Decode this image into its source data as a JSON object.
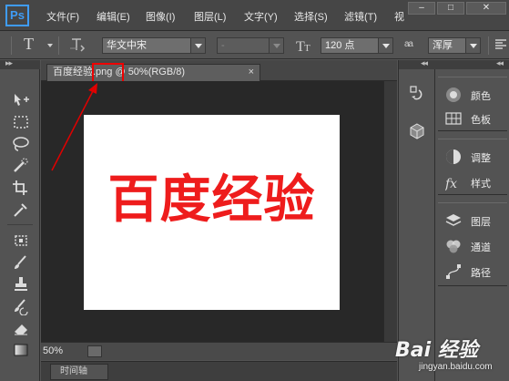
{
  "app": {
    "logo": "Ps"
  },
  "menu": [
    "文件(F)",
    "编辑(E)",
    "图像(I)",
    "图层(L)",
    "文字(Y)",
    "选择(S)",
    "滤镜(T)",
    "视"
  ],
  "window_controls": {
    "minimize": "–",
    "restore": "□",
    "close": "✕"
  },
  "options_bar": {
    "tool_label": "T",
    "font_family": "华文中宋",
    "font_style": "-",
    "font_size": "120 点",
    "aa_label": "a a",
    "antialias": "浑厚"
  },
  "document": {
    "tab_title": "百度经验.png @ 50%(RGB/8)",
    "close": "×",
    "canvas_text": "百度经验",
    "zoom": "50%",
    "text_color": "#ee1c1c"
  },
  "timeline": {
    "label": "时间轴"
  },
  "collapse_glyph": "◂◂",
  "expand_glyph": "▸▸",
  "right_panel": {
    "groups": [
      {
        "items": [
          {
            "icon": "color-icon",
            "label": "颜色"
          },
          {
            "icon": "swatches-icon",
            "label": "色板"
          }
        ]
      },
      {
        "items": [
          {
            "icon": "adjustments-icon",
            "label": "调整"
          },
          {
            "icon": "styles-icon",
            "label": "样式"
          }
        ]
      },
      {
        "items": [
          {
            "icon": "layers-icon",
            "label": "图层"
          },
          {
            "icon": "channels-icon",
            "label": "通道"
          },
          {
            "icon": "paths-icon",
            "label": "路径"
          }
        ]
      }
    ]
  },
  "watermark": {
    "main": "Bai 经验",
    "sub": "jingyan.baidu.com"
  },
  "annotation_color": "#e00000"
}
